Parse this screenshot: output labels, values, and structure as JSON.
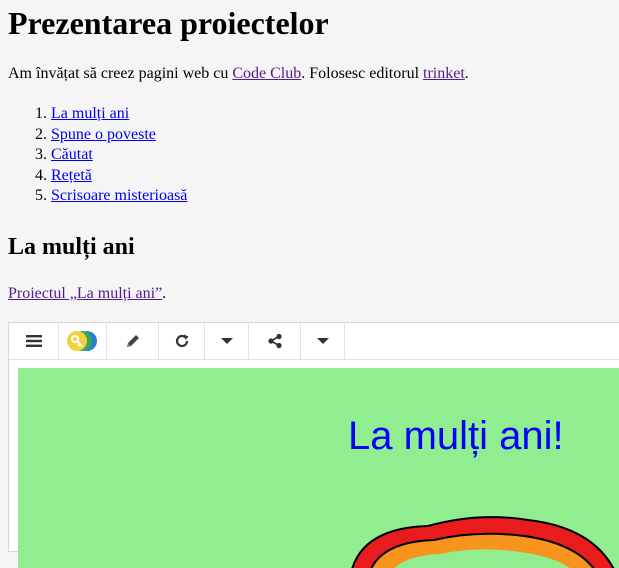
{
  "page": {
    "title": "Prezentarea proiectelor",
    "intro": {
      "text_before": "Am învățat să creez pagini web cu ",
      "code_club_link": "Code Club",
      "text_middle": ". Folosesc editorul ",
      "trinket_link": "trinket",
      "text_after": "."
    },
    "projects": [
      {
        "number": "1.",
        "label": "La mulți ani"
      },
      {
        "number": "2.",
        "label": "Spune o poveste"
      },
      {
        "number": "3.",
        "label": "Căutat"
      },
      {
        "number": "4.",
        "label": "Rețetă"
      },
      {
        "number": "5.",
        "label": "Scrisoare misterioasă"
      }
    ],
    "section": {
      "heading": "La mulți ani",
      "project_link": "Proiectul „La mulți ani”",
      "project_link_suffix": "."
    }
  },
  "embed": {
    "toolbar": {
      "icons": [
        "menu-icon",
        "python-key-icon",
        "pencil-icon",
        "refresh-icon",
        "caret-down-icon",
        "share-icon",
        "caret-down-icon"
      ]
    },
    "stage": {
      "background": "#90ee90",
      "greeting": "La mulți ani!",
      "greeting_color": "#0000ff"
    }
  }
}
